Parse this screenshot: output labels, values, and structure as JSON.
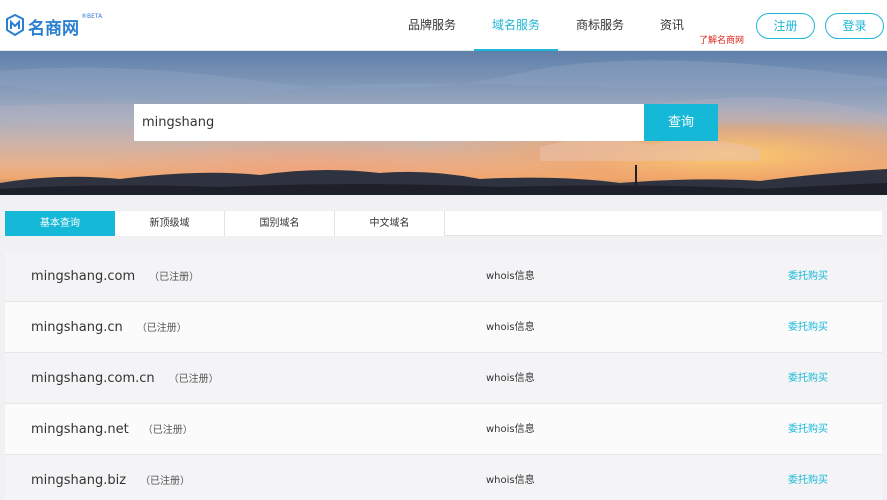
{
  "header": {
    "logo_text": "名商网",
    "logo_badge": "®BETA",
    "nav": [
      {
        "label": "品牌服务",
        "active": false
      },
      {
        "label": "域名服务",
        "active": true
      },
      {
        "label": "商标服务",
        "active": false
      },
      {
        "label": "资讯",
        "active": false
      }
    ],
    "nav_note": "了解名商网",
    "register_label": "注册",
    "login_label": "登录"
  },
  "search": {
    "value": "mingshang",
    "button_label": "查询"
  },
  "tabs": [
    {
      "label": "基本查询",
      "active": true
    },
    {
      "label": "新顶级域",
      "active": false
    },
    {
      "label": "国别域名",
      "active": false
    },
    {
      "label": "中文域名",
      "active": false
    }
  ],
  "results": [
    {
      "domain": "mingshang.com",
      "status": "（已注册）",
      "whois": "whois信息",
      "action": "委托购买"
    },
    {
      "domain": "mingshang.cn",
      "status": "（已注册）",
      "whois": "whois信息",
      "action": "委托购买"
    },
    {
      "domain": "mingshang.com.cn",
      "status": "（已注册）",
      "whois": "whois信息",
      "action": "委托购买"
    },
    {
      "domain": "mingshang.net",
      "status": "（已注册）",
      "whois": "whois信息",
      "action": "委托购买"
    },
    {
      "domain": "mingshang.biz",
      "status": "（已注册）",
      "whois": "whois信息",
      "action": "委托购买"
    }
  ],
  "colors": {
    "accent": "#16b8d8",
    "brand": "#2a7fd1",
    "note": "#e2231a"
  }
}
